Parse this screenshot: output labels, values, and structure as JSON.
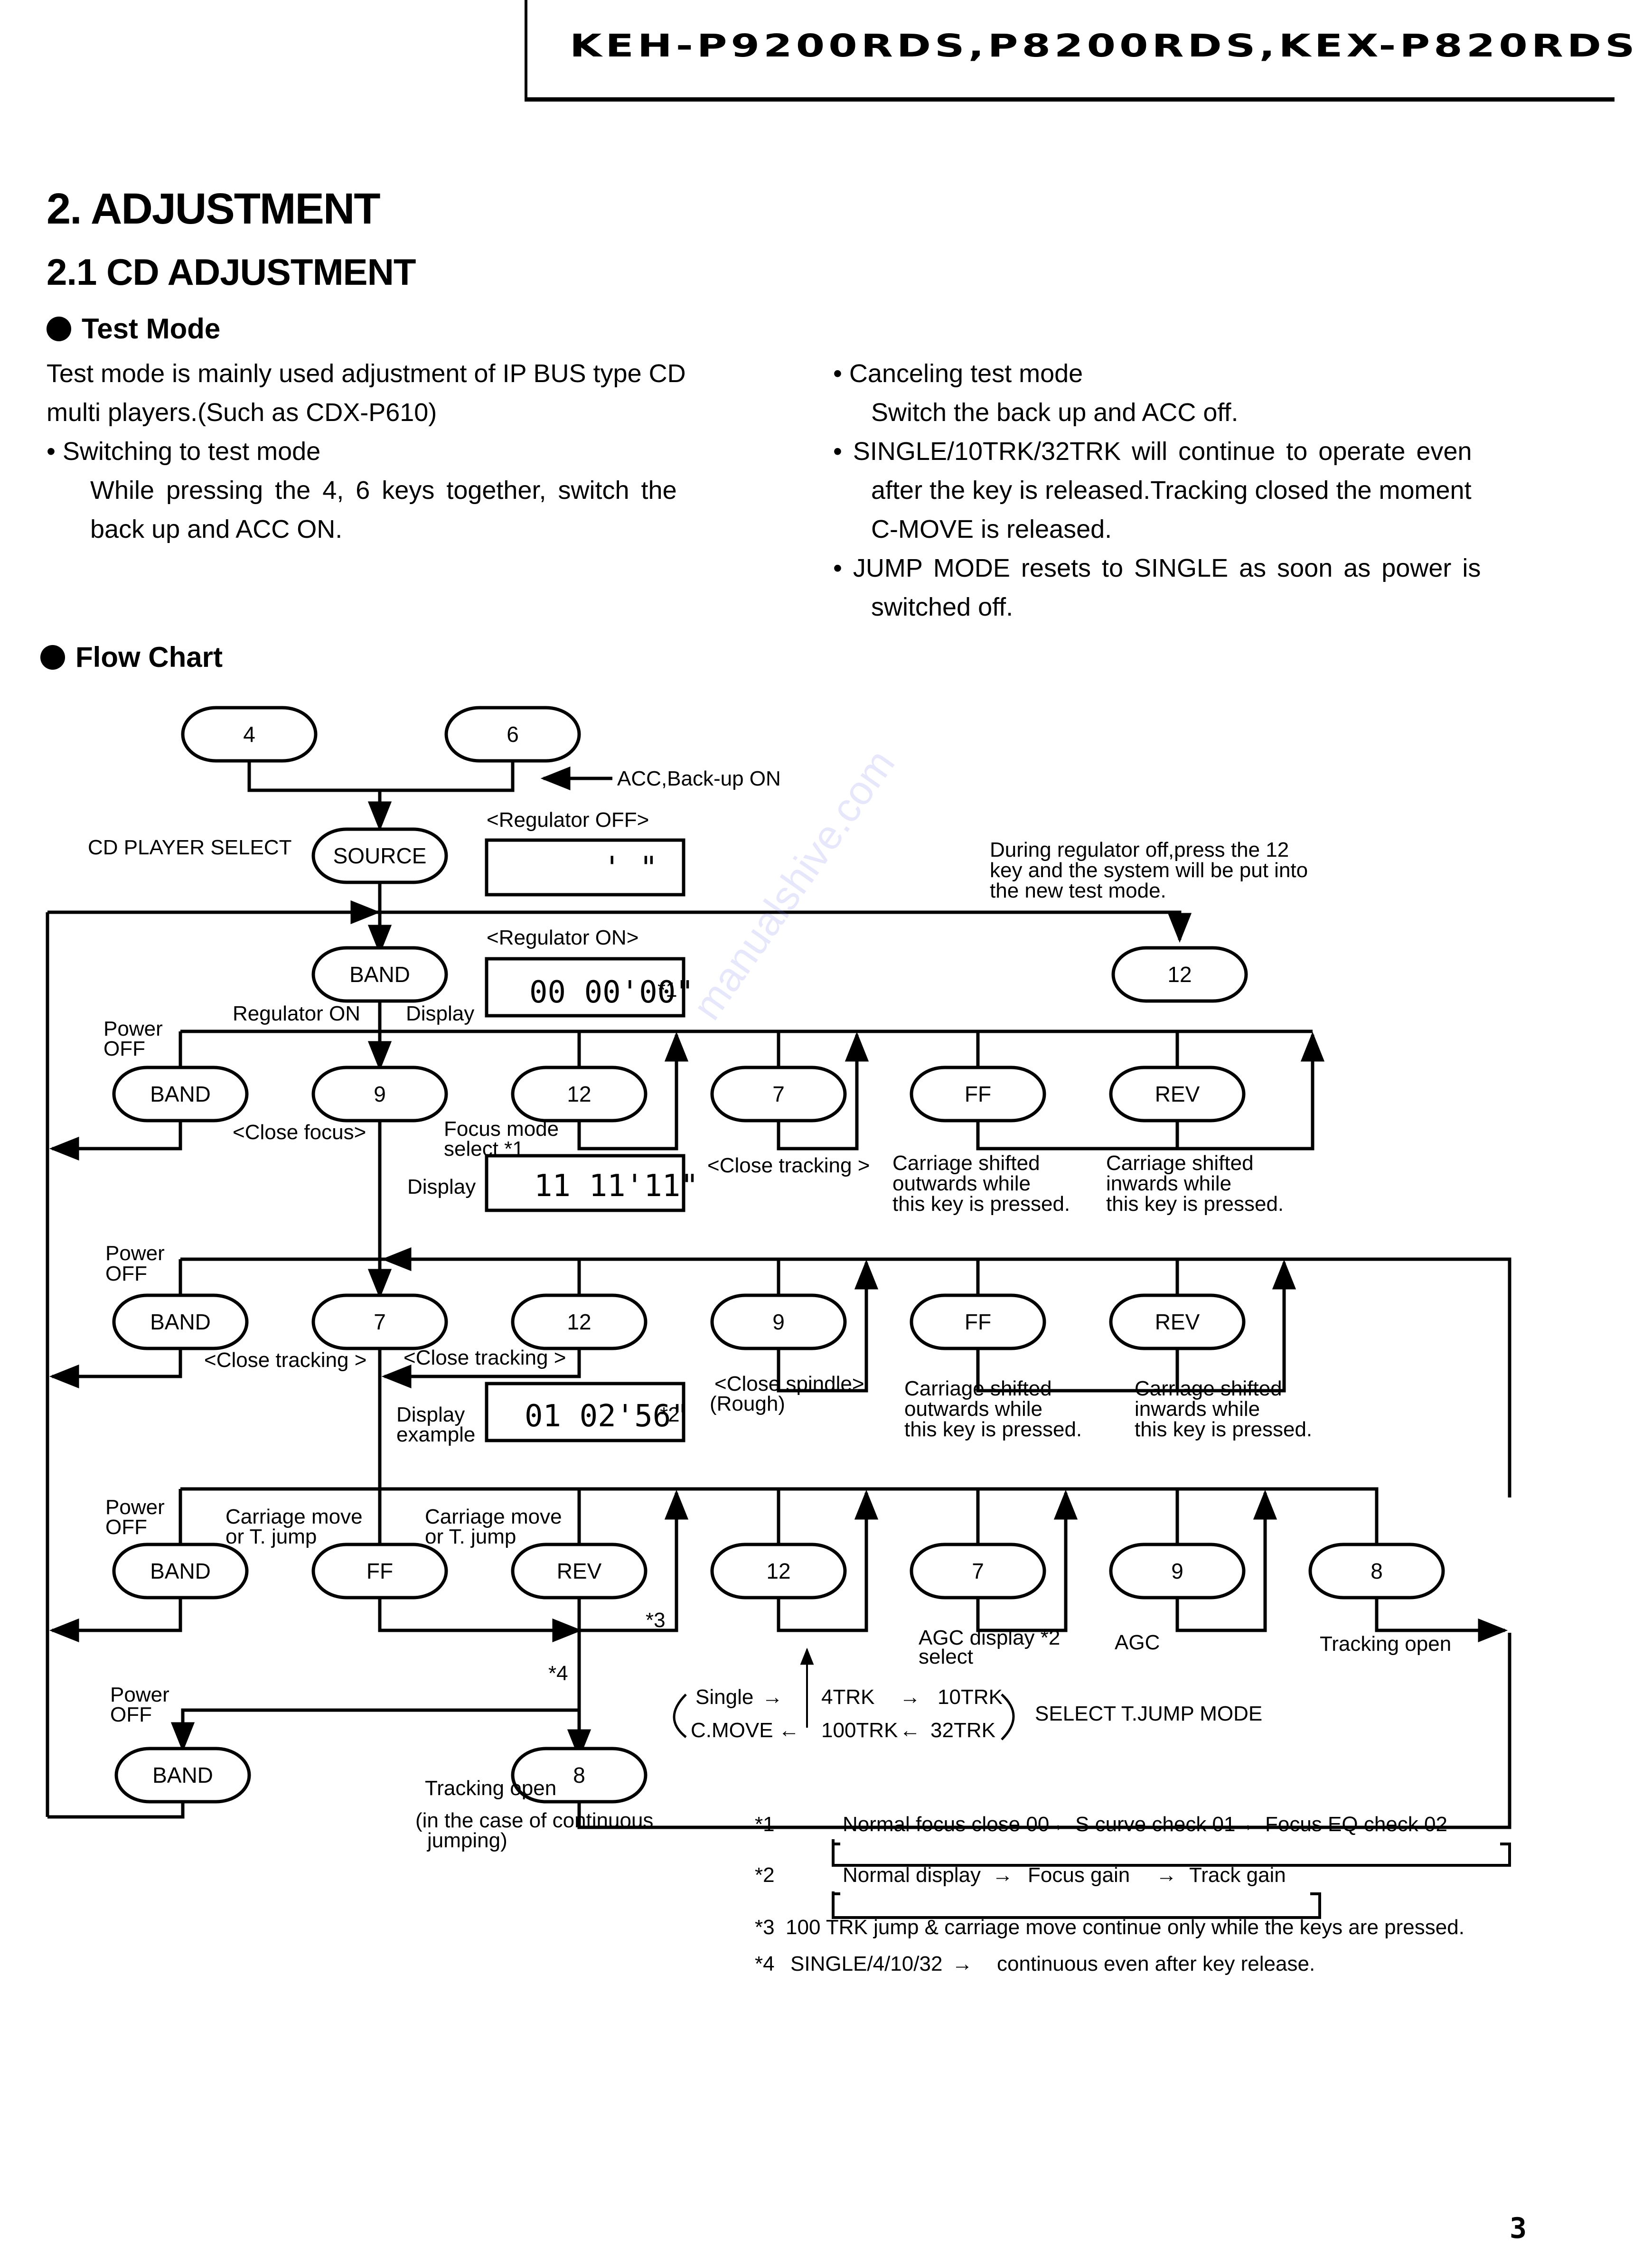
{
  "header": {
    "title": "KEH-P9200RDS,P8200RDS,KEX-P820RDS"
  },
  "section": {
    "heading": "2. ADJUSTMENT",
    "subheading": "2.1 CD ADJUSTMENT",
    "test_mode_heading": "Test Mode",
    "left_column": [
      "Test mode is mainly used adjustment of IP BUS type CD",
      "multi players.(Such as CDX-P610)",
      "• Switching to test mode",
      "While pressing the 4, 6 keys together, switch the",
      "back up and ACC ON."
    ],
    "right_column": [
      "• Canceling test mode",
      "Switch the back up and ACC off.",
      "• SINGLE/10TRK/32TRK will continue to operate even",
      "after the key is released.Tracking closed the moment",
      "C-MOVE is released.",
      "• JUMP MODE resets to SINGLE as soon as power is",
      "switched off."
    ],
    "flow_chart_heading": "Flow Chart"
  },
  "flowchart": {
    "start_keys": [
      "4",
      "6"
    ],
    "acc_note": "ACC,Back-up ON",
    "cd_player_select": "CD PLAYER SELECT",
    "source_key": "SOURCE",
    "regulator_off_label": "<Regulator  OFF>",
    "regulator_off_display": "'  \"",
    "regulator_on_label": "<Regulator  ON>",
    "regulator_on_display": "00 00'00\"",
    "regulator_on_display_note": "*1",
    "band_key": "BAND",
    "regulator_on_text": "Regulator  ON",
    "display_text": "Display",
    "new_test_mode_note": [
      "During regulator off,press the 12",
      "key and the system will be put into",
      "the new test mode."
    ],
    "key_12_top": "12",
    "power_off": [
      "Power",
      "OFF"
    ],
    "row1": {
      "keys": [
        "BAND",
        "9",
        "12",
        "7",
        "FF",
        "REV"
      ],
      "close_focus": "<Close focus>",
      "focus_mode": [
        "Focus  mode",
        "select   *1"
      ],
      "display_label": "Display",
      "display_value": "11  11'11\"",
      "close_tracking": "<Close tracking >",
      "ff_note": [
        "Carriage  shifted",
        "outwards  while",
        "this  key  is  pressed."
      ],
      "rev_note": [
        "Carriage  shifted",
        "inwards  while",
        "this  key  is  pressed."
      ]
    },
    "row2": {
      "keys": [
        "BAND",
        "7",
        "12",
        "9",
        "FF",
        "REV"
      ],
      "close_tracking_7": "<Close tracking >",
      "close_tracking_12": "<Close tracking >",
      "display_label": [
        "Display",
        "example"
      ],
      "display_value": "01 02'56\"",
      "display_note": "*2",
      "close_spindle": [
        "<Close spindle>",
        "(Rough)"
      ],
      "ff_note": [
        "Carriage  shifted",
        "outwards  while",
        "this  key  is  pressed."
      ],
      "rev_note": [
        "Carriage  shifted",
        "inwards  while",
        "this  key  is  pressed."
      ]
    },
    "row3": {
      "keys": [
        "BAND",
        "FF",
        "REV",
        "12",
        "7",
        "9",
        "8"
      ],
      "ff_note": [
        "Carriage move",
        "or T. jump"
      ],
      "rev_note": [
        "Carriage move",
        "or T. jump"
      ],
      "star3": "*3",
      "agc_display": [
        "AGC display *2",
        "select"
      ],
      "agc": "AGC",
      "tracking_open": "Tracking  open"
    },
    "jump_mode": {
      "top": [
        "Single",
        "4TRK",
        "10TRK"
      ],
      "bottom": [
        "C.MOVE",
        "100TRK",
        "32TRK"
      ],
      "label": "SELECT T.JUMP MODE"
    },
    "row4": {
      "keys": [
        "BAND",
        "8"
      ],
      "star4": "*4",
      "tracking_open": "Tracking  open",
      "continuous_note": [
        "(in the case of continuous",
        "jumping)"
      ]
    }
  },
  "footnotes": {
    "n1": {
      "mark": "*1",
      "steps": [
        "Normal focus close 00",
        "S curve check 01",
        "Focus EQ check 02"
      ]
    },
    "n2": {
      "mark": "*2",
      "steps": [
        "Normal display",
        "Focus gain",
        "Track gain"
      ]
    },
    "n3": {
      "mark": "*3",
      "text": "100 TRK jump & carriage move continue only while the keys are pressed."
    },
    "n4": {
      "mark": "*4",
      "text": "SINGLE/4/10/32",
      "text2": "continuous even after key release."
    }
  },
  "watermark": "manualshive.com",
  "page_number": "3"
}
